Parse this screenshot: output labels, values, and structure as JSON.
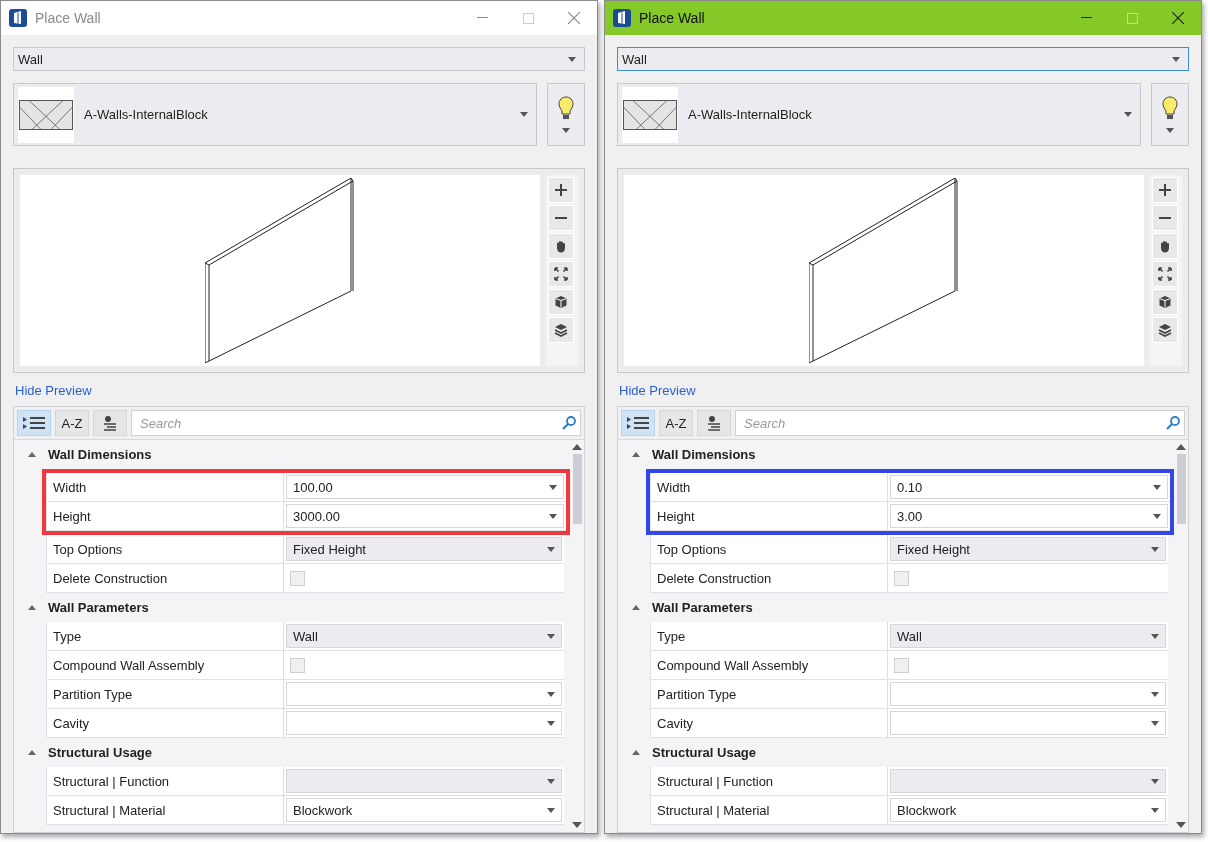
{
  "windows": [
    {
      "title": "Place Wall",
      "active": false,
      "mode_combo": {
        "value": "Wall",
        "focused": false
      },
      "template": "A-Walls-InternalBlock",
      "hide_preview": "Hide Preview",
      "view_mode_a_z": "A-Z",
      "categorized_selected": true,
      "search": {
        "placeholder": "Search"
      },
      "highlight": {
        "color": "#f0383e"
      },
      "sections": [
        {
          "title": "Wall Dimensions",
          "expanded": true,
          "properties": [
            {
              "label": "Width",
              "kind": "dropdown",
              "value": "100.00",
              "disabled": false,
              "highlighted": true
            },
            {
              "label": "Height",
              "kind": "dropdown",
              "value": "3000.00",
              "disabled": false,
              "highlighted": true
            },
            {
              "label": "Top Options",
              "kind": "dropdown",
              "value": "Fixed Height",
              "disabled": true,
              "highlighted": false
            },
            {
              "label": "Delete Construction",
              "kind": "checkbox",
              "checked": false,
              "disabled": true,
              "highlighted": false
            }
          ]
        },
        {
          "title": "Wall Parameters",
          "expanded": true,
          "properties": [
            {
              "label": "Type",
              "kind": "dropdown",
              "value": "Wall",
              "disabled": true,
              "highlighted": false
            },
            {
              "label": "Compound Wall Assembly",
              "kind": "checkbox",
              "checked": false,
              "disabled": true,
              "highlighted": false
            },
            {
              "label": "Partition Type",
              "kind": "dropdown",
              "disabled": false,
              "highlighted": false
            },
            {
              "label": "Cavity",
              "kind": "dropdown",
              "disabled": false,
              "highlighted": false
            }
          ]
        },
        {
          "title": "Structural Usage",
          "expanded": true,
          "properties": [
            {
              "label": "Structural | Function",
              "kind": "dropdown",
              "disabled": true,
              "highlighted": false
            },
            {
              "label": "Structural | Material",
              "kind": "dropdown",
              "value": "Blockwork",
              "disabled": false,
              "highlighted": false
            }
          ]
        }
      ]
    },
    {
      "title": "Place Wall",
      "active": true,
      "mode_combo": {
        "value": "Wall",
        "focused": true
      },
      "template": "A-Walls-InternalBlock",
      "hide_preview": "Hide Preview",
      "view_mode_a_z": "A-Z",
      "categorized_selected": true,
      "search": {
        "placeholder": "Search"
      },
      "highlight": {
        "color": "#3347e8"
      },
      "sections": [
        {
          "title": "Wall Dimensions",
          "expanded": true,
          "properties": [
            {
              "label": "Width",
              "kind": "dropdown",
              "value": "0.10",
              "disabled": false,
              "highlighted": true
            },
            {
              "label": "Height",
              "kind": "dropdown",
              "value": "3.00",
              "disabled": false,
              "highlighted": true
            },
            {
              "label": "Top Options",
              "kind": "dropdown",
              "value": "Fixed Height",
              "disabled": true,
              "highlighted": false
            },
            {
              "label": "Delete Construction",
              "kind": "checkbox",
              "checked": false,
              "disabled": true,
              "highlighted": false
            }
          ]
        },
        {
          "title": "Wall Parameters",
          "expanded": true,
          "properties": [
            {
              "label": "Type",
              "kind": "dropdown",
              "value": "Wall",
              "disabled": true,
              "highlighted": false
            },
            {
              "label": "Compound Wall Assembly",
              "kind": "checkbox",
              "checked": false,
              "disabled": true,
              "highlighted": false
            },
            {
              "label": "Partition Type",
              "kind": "dropdown",
              "disabled": false,
              "highlighted": false
            },
            {
              "label": "Cavity",
              "kind": "dropdown",
              "disabled": false,
              "highlighted": false
            }
          ]
        },
        {
          "title": "Structural Usage",
          "expanded": true,
          "properties": [
            {
              "label": "Structural | Function",
              "kind": "dropdown",
              "disabled": true,
              "highlighted": false
            },
            {
              "label": "Structural | Material",
              "kind": "dropdown",
              "value": "Blockwork",
              "disabled": false,
              "highlighted": false
            }
          ]
        }
      ]
    }
  ]
}
